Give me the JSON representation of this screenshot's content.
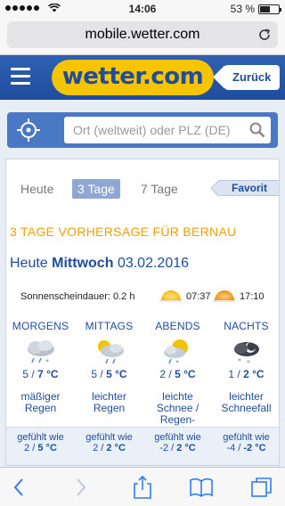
{
  "status_bar": {
    "time": "14:06",
    "battery": "53 %",
    "battery_level": 0.53
  },
  "browser": {
    "url": "mobile.wetter.com"
  },
  "header": {
    "logo": "wetter.com",
    "back_label": "Zurück"
  },
  "search": {
    "placeholder": "Ort (weltweit) oder PLZ (DE)"
  },
  "tabs": [
    {
      "label": "Heute",
      "active": false
    },
    {
      "label": "3 Tage",
      "active": true
    },
    {
      "label": "7 Tage",
      "active": false
    }
  ],
  "favorite_label": "Favorit",
  "forecast": {
    "headline": "3 TAGE VORHERSAGE FÜR BERNAU",
    "day_prefix": "Heute",
    "weekday": "Mittwoch",
    "date": "03.02.2016",
    "sunshine_label": "Sonnenscheindauer: 0.2 h",
    "sunrise": "07:37",
    "sunset": "17:10",
    "periods": [
      {
        "name": "MORGENS",
        "icon": "snow-rain-cloud-icon",
        "temp_min": "5",
        "temp_max": "7 °C",
        "description": "mäßiger Regen",
        "felt_label": "gefühlt wie",
        "felt_min": "2",
        "felt_max": "5 °C"
      },
      {
        "name": "MITTAGS",
        "icon": "sun-cloud-rain-icon",
        "temp_min": "5",
        "temp_max": "5 °C",
        "description": "leichter Regen",
        "felt_label": "gefühlt wie",
        "felt_min": "2",
        "felt_max": "2 °C"
      },
      {
        "name": "ABENDS",
        "icon": "sun-cloud-snow-icon",
        "temp_min": "2",
        "temp_max": "5 °C",
        "description": "leichte Schnee / Regen-schauer",
        "felt_label": "gefühlt wie",
        "felt_min": "-2",
        "felt_max": "2 °C"
      },
      {
        "name": "NACHTS",
        "icon": "moon-cloud-snow-icon",
        "temp_min": "1",
        "temp_max": "2 °C",
        "description": "leichter Schneefall",
        "felt_label": "gefühlt wie",
        "felt_min": "-4",
        "felt_max": "-2 °C"
      }
    ]
  },
  "colors": {
    "brand_blue": "#1f4d9e",
    "brand_yellow": "#f6c400",
    "headline_orange": "#f0a000"
  }
}
